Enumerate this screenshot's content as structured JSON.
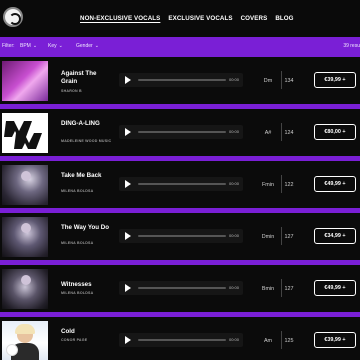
{
  "header": {
    "nav": [
      {
        "label": "NON-EXCLUSIVE VOCALS",
        "active": true
      },
      {
        "label": "EXCLUSIVE VOCALS",
        "active": false
      },
      {
        "label": "COVERS",
        "active": false
      },
      {
        "label": "BLOG",
        "active": false
      }
    ]
  },
  "filters": {
    "label": "Filter:",
    "bpm": "BPM",
    "key": "Key",
    "gender": "Gender",
    "results": "39 resu"
  },
  "tracks": [
    {
      "title": "Against The Grain",
      "artist": "SHARON B",
      "time": "00:00",
      "key": "Dm",
      "bpm": "134",
      "price": "€39,99 +"
    },
    {
      "title": "DING-A-LING",
      "artist": "MADELEINE WOOD MUSIC",
      "time": "00:00",
      "key": "A#",
      "bpm": "124",
      "price": "€80,00 +"
    },
    {
      "title": "Take Me Back",
      "artist": "MILENA BOLDSA",
      "time": "00:00",
      "key": "Fmin",
      "bpm": "122",
      "price": "€49,99 +"
    },
    {
      "title": "The Way You Do",
      "artist": "MILENA BOLDSA",
      "time": "00:00",
      "key": "Dmin",
      "bpm": "127",
      "price": "€34,99 +"
    },
    {
      "title": "Witnesses",
      "artist": "MILENA BOLDSA",
      "time": "00:00",
      "key": "Bmin",
      "bpm": "127",
      "price": "€49,99 +"
    },
    {
      "title": "Cold",
      "artist": "CONOR PAGE",
      "time": "00:00",
      "key": "Am",
      "bpm": "125",
      "price": "€39,99 +"
    }
  ],
  "colors": {
    "accent": "#7a1fd6",
    "rowBg": "#0b0b0b"
  }
}
